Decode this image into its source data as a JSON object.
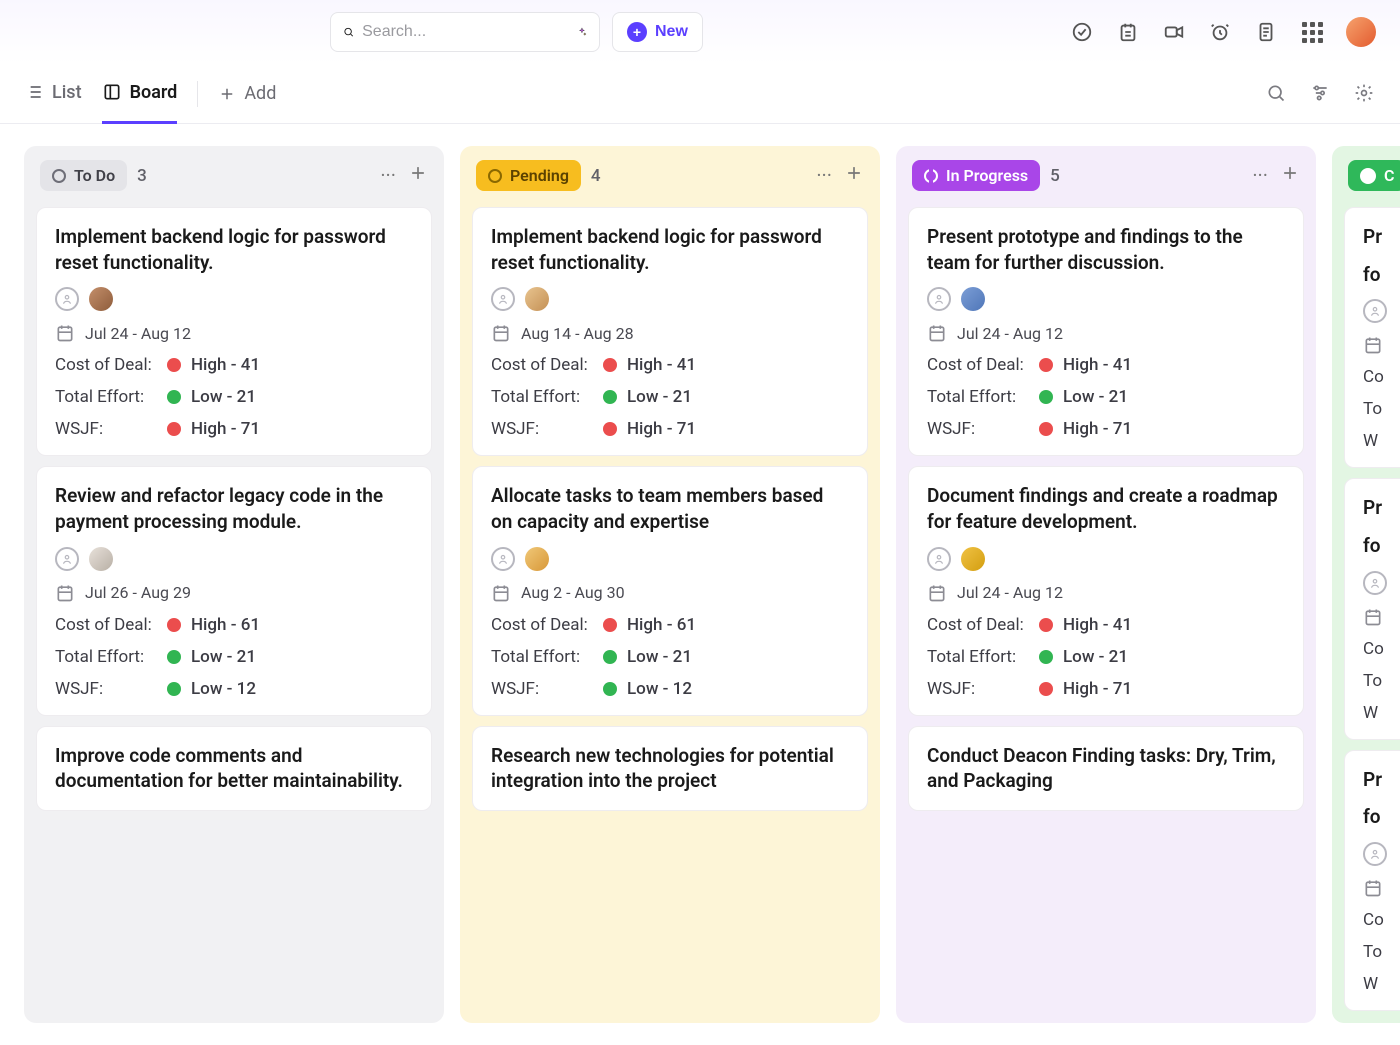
{
  "header": {
    "search_placeholder": "Search...",
    "new_label": "New"
  },
  "views": {
    "list": "List",
    "board": "Board",
    "add": "Add"
  },
  "metric_labels": {
    "cost_of_deal": "Cost of Deal:",
    "total_effort": "Total Effort:",
    "wsjf": "WSJF:"
  },
  "priority_levels": {
    "high": "High",
    "low": "Low"
  },
  "columns": [
    {
      "id": "todo",
      "name": "To Do",
      "count": 3,
      "cards": [
        {
          "title": "Implement backend logic for password reset functionality.",
          "date": "Jul 24 - Aug 12",
          "avatar_bg": "linear-gradient(135deg,#c48f6b,#8e5c3b)",
          "cost_of_deal": {
            "level": "high",
            "text": "High - 41"
          },
          "total_effort": {
            "level": "low",
            "text": "Low - 21"
          },
          "wsjf": {
            "level": "high",
            "text": "High - 71"
          }
        },
        {
          "title": "Review and refactor legacy code in the payment processing module.",
          "date": "Jul 26 - Aug 29",
          "avatar_bg": "linear-gradient(135deg,#e8e1da,#b8afa5)",
          "cost_of_deal": {
            "level": "high",
            "text": "High - 61"
          },
          "total_effort": {
            "level": "low",
            "text": "Low - 21"
          },
          "wsjf": {
            "level": "low",
            "text": "Low - 12"
          }
        },
        {
          "title": "Improve code comments and documentation for better maintainability.",
          "partial": true
        }
      ]
    },
    {
      "id": "pending",
      "name": "Pending",
      "count": 4,
      "cards": [
        {
          "title": "Implement backend logic for password reset functionality.",
          "date": "Aug 14 - Aug 28",
          "avatar_bg": "linear-gradient(135deg,#e8c48f,#c49055)",
          "cost_of_deal": {
            "level": "high",
            "text": "High - 41"
          },
          "total_effort": {
            "level": "low",
            "text": "Low - 21"
          },
          "wsjf": {
            "level": "high",
            "text": "High - 71"
          }
        },
        {
          "title": "Allocate tasks to team members based on capacity and expertise",
          "date": "Aug 2 - Aug 30",
          "avatar_bg": "linear-gradient(135deg,#f0c878,#d89838)",
          "cost_of_deal": {
            "level": "high",
            "text": "High - 61"
          },
          "total_effort": {
            "level": "low",
            "text": "Low - 21"
          },
          "wsjf": {
            "level": "low",
            "text": "Low - 12"
          }
        },
        {
          "title": "Research new technologies for potential integration into the project",
          "partial": true
        }
      ]
    },
    {
      "id": "inprogress",
      "name": "In Progress",
      "count": 5,
      "cards": [
        {
          "title": "Present prototype and findings to the team for further discussion.",
          "date": "Jul 24 - Aug 12",
          "avatar_bg": "linear-gradient(135deg,#7c9ed6,#4f76b8)",
          "cost_of_deal": {
            "level": "high",
            "text": "High - 41"
          },
          "total_effort": {
            "level": "low",
            "text": "Low - 21"
          },
          "wsjf": {
            "level": "high",
            "text": "High - 71"
          }
        },
        {
          "title": "Document findings and create a roadmap for feature development.",
          "date": "Jul 24 - Aug 12",
          "avatar_bg": "linear-gradient(135deg,#f0c244,#d39e10)",
          "cost_of_deal": {
            "level": "high",
            "text": "High - 41"
          },
          "total_effort": {
            "level": "low",
            "text": "Low - 21"
          },
          "wsjf": {
            "level": "high",
            "text": "High - 71"
          }
        },
        {
          "title": "Conduct Deacon Finding tasks: Dry, Trim, and Packaging",
          "partial": true
        }
      ]
    },
    {
      "id": "complete",
      "name": "C",
      "count": null,
      "cards": [
        {
          "title_fragment": "Pr",
          "line2": "fo",
          "partial": true
        },
        {
          "title_fragment": "Pr",
          "line2": "fo",
          "partial": true
        },
        {
          "title_fragment": "Pr",
          "line2": "fo",
          "partial": true
        }
      ]
    }
  ]
}
